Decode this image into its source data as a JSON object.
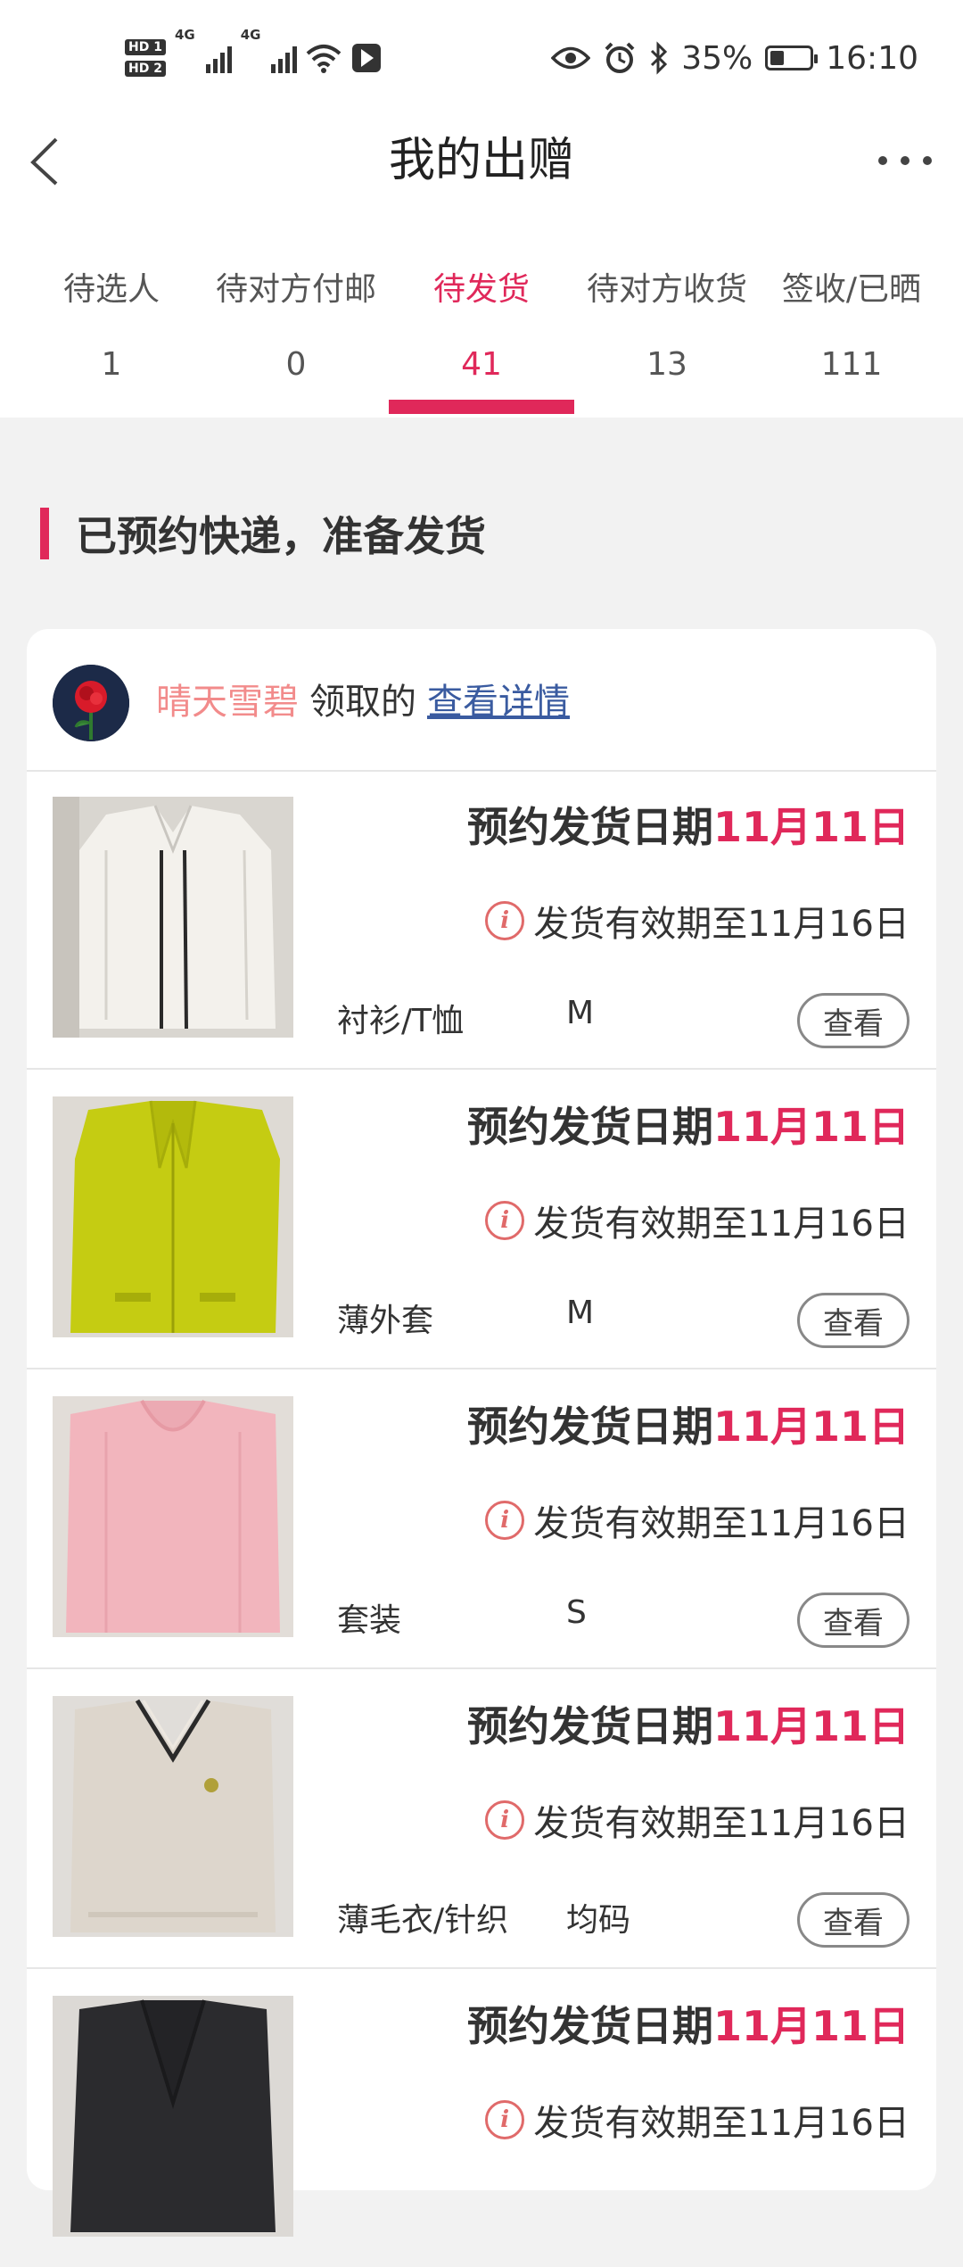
{
  "status_bar": {
    "sim1": "HD 1",
    "sim2": "HD 2",
    "net1": "4G",
    "net2": "4G",
    "battery_percent": "35%",
    "battery_level": 0.35,
    "time": "16:10",
    "icons": [
      "signal-icon",
      "wifi-icon",
      "app-notification-icon",
      "eye-icon",
      "alarm-icon",
      "bluetooth-icon",
      "battery-icon"
    ]
  },
  "nav": {
    "title": "我的出赠"
  },
  "tabs": [
    {
      "label": "待选人",
      "count": "1"
    },
    {
      "label": "待对方付邮",
      "count": "0"
    },
    {
      "label": "待发货",
      "count": "41"
    },
    {
      "label": "待对方收货",
      "count": "13"
    },
    {
      "label": "签收/已晒",
      "count": "111"
    }
  ],
  "active_tab": 2,
  "accent_color": "#e0285a",
  "section": {
    "title": "已预约快递，准备发货"
  },
  "user": {
    "name": "晴天雪碧",
    "claimed_text": "领取的",
    "details_link": "查看详情"
  },
  "items": [
    {
      "date_label": "预约发货日期",
      "date_value": "11月11日",
      "deadline": "发货有效期至11月16日",
      "category": "衬衫/T恤",
      "size": "M",
      "button": "查看",
      "photo": "white-shirt"
    },
    {
      "date_label": "预约发货日期",
      "date_value": "11月11日",
      "deadline": "发货有效期至11月16日",
      "category": "薄外套",
      "size": "M",
      "button": "查看",
      "photo": "yellow-jacket"
    },
    {
      "date_label": "预约发货日期",
      "date_value": "11月11日",
      "deadline": "发货有效期至11月16日",
      "category": "套装",
      "size": "S",
      "button": "查看",
      "photo": "pink-top"
    },
    {
      "date_label": "预约发货日期",
      "date_value": "11月11日",
      "deadline": "发货有效期至11月16日",
      "category": "薄毛衣/针织",
      "size": "均码",
      "button": "查看",
      "photo": "beige-sweater"
    },
    {
      "date_label": "预约发货日期",
      "date_value": "11月11日",
      "deadline": "发货有效期至11月16日",
      "category": "",
      "size": "",
      "button": "",
      "photo": "black-cardigan"
    }
  ]
}
